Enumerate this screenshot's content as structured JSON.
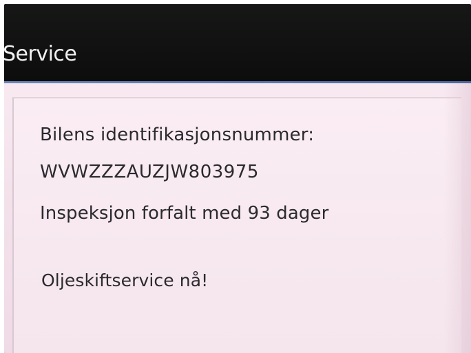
{
  "header": {
    "title": "Service"
  },
  "service_panel": {
    "vin_label": "Bilens identifikasjonsnummer:",
    "vin_value": "WVWZZZAUZJW803975",
    "inspection_status": "Inspeksjon forfalt med 93 dager",
    "oil_change_message": "Oljeskiftservice nå!"
  },
  "colors": {
    "header_background": "#101110",
    "accent_line": "#5b76ae",
    "panel_background": "#f5e5ed",
    "text": "#2a2a2e",
    "title_text": "#f2f2f2"
  }
}
